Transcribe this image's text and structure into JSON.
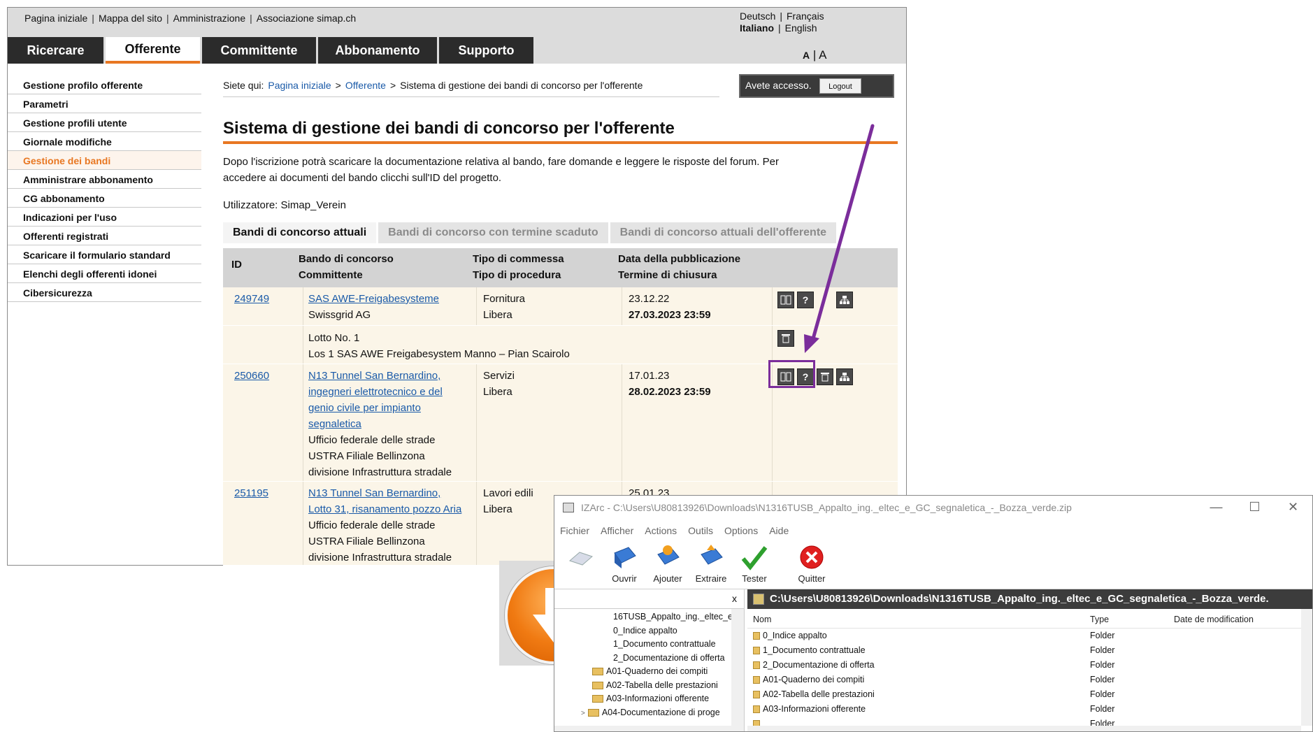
{
  "top_links": [
    "Pagina iniziale",
    "Mappa del sito",
    "Amministrazione",
    "Associazione simap.ch"
  ],
  "languages": {
    "row1": [
      "Deutsch",
      "Français"
    ],
    "row2": [
      "Italiano",
      "English"
    ]
  },
  "nav_tabs": [
    "Ricercare",
    "Offerente",
    "Committente",
    "Abbonamento",
    "Supporto"
  ],
  "font_size": {
    "small": "A",
    "sep": "|",
    "large": "A"
  },
  "left_menu": [
    "Gestione profilo offerente",
    "Parametri",
    "Gestione profili utente",
    "Giornale modifiche",
    "Gestione dei bandi",
    "Amministrare abbonamento",
    "CG abbonamento",
    "Indicazioni per l'uso",
    "Offerenti registrati",
    "Scaricare il formulario standard",
    "Elenchi degli offerenti idonei",
    "Cibersicurezza"
  ],
  "breadcrumb": {
    "prefix": "Siete qui:",
    "home": "Pagina iniziale",
    "sep": ">",
    "section": "Offerente",
    "current": "Sistema di gestione dei bandi di concorso per l'offerente"
  },
  "access": {
    "text": "Avete accesso.",
    "logout": "Logout"
  },
  "page_title": "Sistema di gestione dei bandi di concorso per l'offerente",
  "intro_line1": "Dopo l'iscrizione potrà scaricare la documentazione relativa al bando, fare domande e leggere le risposte del forum. Per",
  "intro_line2": "accedere ai documenti del bando clicchi sull'ID del progetto.",
  "user": "Utilizzatore: Simap_Verein",
  "tabs": [
    "Bandi di concorso attuali",
    "Bandi di concorso con termine scaduto",
    "Bandi di concorso attuali dell'offerente"
  ],
  "table": {
    "headers": {
      "id": "ID",
      "bando_1": "Bando di concorso",
      "bando_2": "Committente",
      "tipo_1": "Tipo di commessa",
      "tipo_2": "Tipo di procedura",
      "data_1": "Data della pubblicazione",
      "data_2": "Termine di chiusura"
    },
    "rows": [
      {
        "id": "249749",
        "title": "SAS AWE-Freigabesysteme",
        "committente": "Swissgrid AG",
        "tipo": "Fornitura",
        "procedura": "Libera",
        "pub": "23.12.22",
        "chiusura": "27.03.2023 23:59",
        "lotto": "Lotto No. 1",
        "lotto_desc": "Los 1 SAS AWE Freigabesystem Manno – Pian Scairolo"
      },
      {
        "id": "250660",
        "title_lines": [
          "N13 Tunnel San Bernardino,",
          "ingegneri elettrotecnico e del",
          "genio civile per impianto",
          "segnaletica"
        ],
        "committente_lines": [
          "Ufficio federale delle strade",
          "USTRA Filiale Bellinzona",
          "divisione Infrastruttura stradale"
        ],
        "tipo": "Servizi",
        "procedura": "Libera",
        "pub": "17.01.23",
        "chiusura": "28.02.2023 23:59"
      },
      {
        "id": "251195",
        "title_lines": [
          "N13 Tunnel San Bernardino,",
          "Lotto 31, risanamento pozzo Aria"
        ],
        "committente_lines": [
          "Ufficio federale delle strade",
          "USTRA Filiale Bellinzona",
          "divisione Infrastruttura stradale"
        ],
        "tipo": "Lavori edili",
        "procedura": "Libera",
        "pub": "25.01.23"
      }
    ]
  },
  "izarc": {
    "title": "IZArc - C:\\Users\\U80813926\\Downloads\\N1316TUSB_Appalto_ing._eltec_e_GC_segnaletica_-_Bozza_verde.zip",
    "menu": [
      "Fichier",
      "Afficher",
      "Actions",
      "Outils",
      "Options",
      "Aide"
    ],
    "toolbar": [
      "Ouvrir",
      "Ajouter",
      "Extraire",
      "Tester",
      "Quitter"
    ],
    "left_close": "x",
    "tree": [
      "16TUSB_Appalto_ing._eltec_e",
      "0_Indice appalto",
      "1_Documento contrattuale",
      "2_Documentazione di offerta",
      "A01-Quaderno dei compiti",
      "A02-Tabella delle prestazioni",
      "A03-Informazioni offerente",
      "A04-Documentazione di proge"
    ],
    "path": "C:\\Users\\U80813926\\Downloads\\N1316TUSB_Appalto_ing._eltec_e_GC_segnaletica_-_Bozza_verde.",
    "columns": [
      "Nom",
      "Type",
      "Date de modification"
    ],
    "files": [
      {
        "name": "0_Indice appalto",
        "type": "Folder"
      },
      {
        "name": "1_Documento contrattuale",
        "type": "Folder"
      },
      {
        "name": "2_Documentazione di offerta",
        "type": "Folder"
      },
      {
        "name": "A01-Quaderno dei compiti",
        "type": "Folder"
      },
      {
        "name": "A02-Tabella delle prestazioni",
        "type": "Folder"
      },
      {
        "name": "A03-Informazioni offerente",
        "type": "Folder"
      },
      {
        "name": "",
        "type": "Folder"
      }
    ]
  },
  "colors": {
    "accent": "#e87722",
    "nav_dark": "#2b2b2b",
    "annotation": "#7b2d9b",
    "link": "#1a5aa8"
  }
}
